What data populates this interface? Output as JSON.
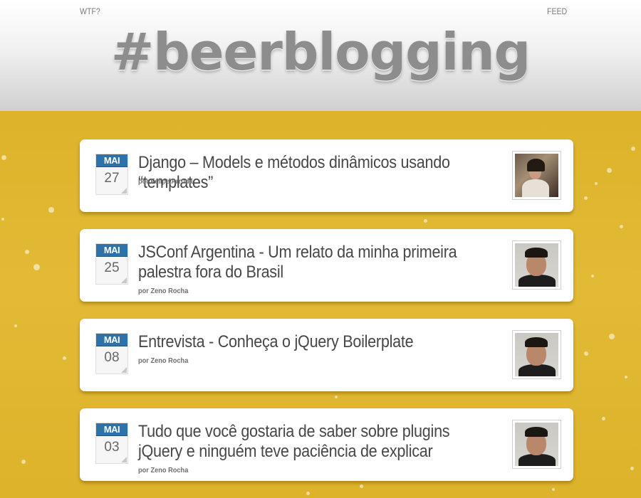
{
  "nav": {
    "left_link": "WTF?",
    "right_link": "FEED"
  },
  "site_title": "#beerblogging",
  "colors": {
    "beer": "#dcb32a",
    "month_badge": "#2f72a8",
    "title_text": "#8d8d8d"
  },
  "posts": [
    {
      "month": "MAI",
      "day": "27",
      "title": "Django – Models e métodos dinâmicos usando “templates”",
      "byline": "por Felipe Arruda",
      "avatar_icon": "author-photo-felipe-arruda"
    },
    {
      "month": "MAI",
      "day": "25",
      "title": "JSConf Argentina - Um relato da minha primeira palestra fora do Brasil",
      "byline": "por Zeno Rocha",
      "avatar_icon": "author-photo-zeno-rocha"
    },
    {
      "month": "MAI",
      "day": "08",
      "title": "Entrevista - Conheça o jQuery Boilerplate",
      "byline": "por Zeno Rocha",
      "avatar_icon": "author-photo-zeno-rocha"
    },
    {
      "month": "MAI",
      "day": "03",
      "title": "Tudo que você gostaria de saber sobre plugins jQuery e ninguém teve paciência de explicar",
      "byline": "por Zeno Rocha",
      "avatar_icon": "author-photo-zeno-rocha"
    }
  ]
}
